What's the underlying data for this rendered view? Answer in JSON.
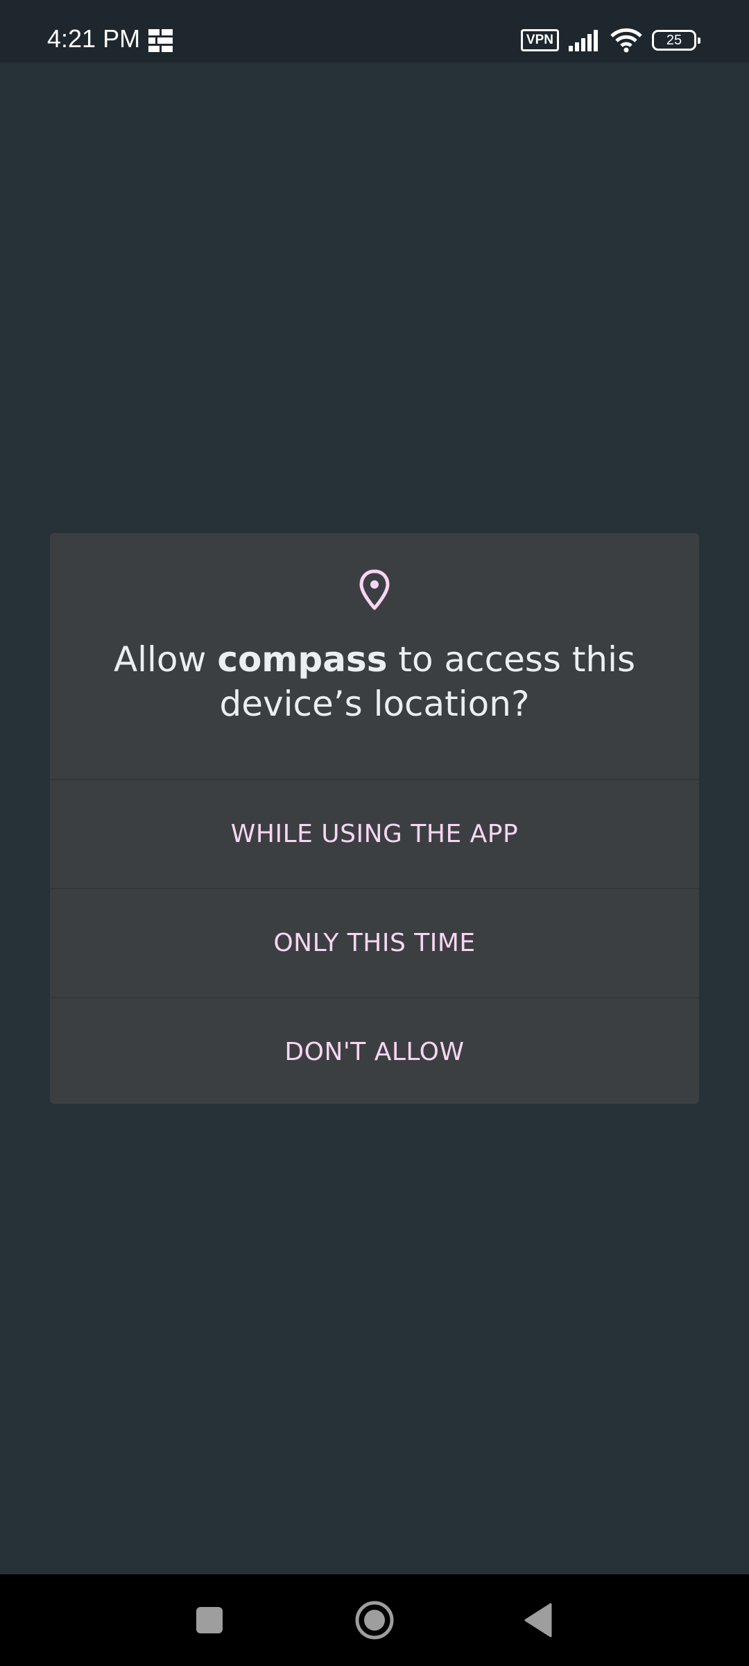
{
  "status_bar": {
    "time": "4:21 PM",
    "vpn_label": "VPN",
    "battery_level": "25",
    "icons": [
      "grid-notification-icon",
      "vpn-icon",
      "signal-icon",
      "wifi-icon",
      "battery-icon"
    ]
  },
  "dialog": {
    "icon": "location-pin-icon",
    "title_prefix": "Allow ",
    "title_app": "compass",
    "title_suffix": " to access this device’s location?",
    "buttons": [
      {
        "label": "WHILE USING THE APP"
      },
      {
        "label": "ONLY THIS TIME"
      },
      {
        "label": "DON'T ALLOW"
      }
    ]
  },
  "nav_bar": {
    "icons": [
      "recents-square-icon",
      "home-circle-icon",
      "back-triangle-icon"
    ]
  },
  "colors": {
    "background": "#263238",
    "dialog": "#3c3f42",
    "accent": "#f7d6f3",
    "status_bar": "#1e272d",
    "nav_bar": "#000000"
  }
}
